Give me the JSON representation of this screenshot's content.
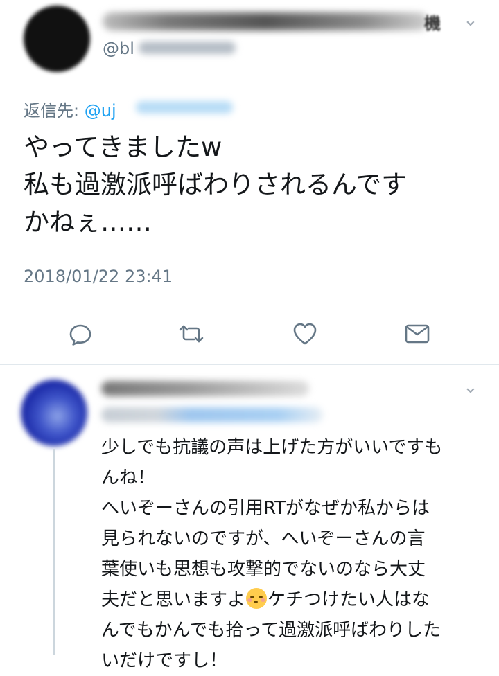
{
  "tweet": {
    "handle_prefix": "@bl",
    "name_suffix": "機",
    "menu_icon": "chevron-down-icon",
    "reply_to_label": "返信先:",
    "reply_to_prefix": "@uj",
    "text": "やってきましたw\n私も過激派呼ばわりされるんです\nかねぇ……",
    "timestamp": "2018/01/22 23:41"
  },
  "actions": [
    {
      "name": "reply",
      "icon": "reply-icon"
    },
    {
      "name": "retweet",
      "icon": "retweet-icon"
    },
    {
      "name": "like",
      "icon": "heart-icon"
    },
    {
      "name": "direct-message",
      "icon": "envelope-icon"
    }
  ],
  "reply": {
    "menu_icon": "chevron-down-icon",
    "text_before_emoji": "少しでも抗議の声は上げた方がいいですも\nんね！\nへいぞーさんの引用RTがなぜか私からは\n見られないのですが、へいぞーさんの言\n葉使いも思想も攻撃的でないのなら大丈\n夫だと思いますよ",
    "emoji": "relieved-face-emoji",
    "text_after_emoji": "ケチつけたい人はな\nんでもかんでも拾って過激派呼ばわりした\nいだけですし！"
  },
  "colors": {
    "text": "#14171a",
    "secondary": "#657786",
    "link": "#1da1f2",
    "divider": "#e1e8ed",
    "thread_line": "#ccd6dd"
  }
}
